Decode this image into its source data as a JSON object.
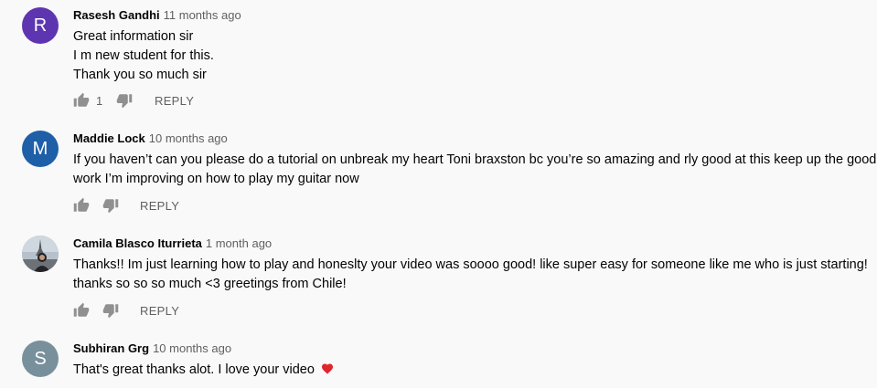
{
  "colors": {
    "avatar_r": "#5e35b1",
    "avatar_m": "#1e5fa8",
    "avatar_s": "#78909c",
    "heart": "#e0262c"
  },
  "comments": [
    {
      "author": "Rasesh Gandhi",
      "time": "11 months ago",
      "avatar_letter": "R",
      "lines": [
        "Great information sir",
        "I m new student for this.",
        "Thank you so much sir"
      ],
      "likes": "1",
      "reply": "REPLY"
    },
    {
      "author": "Maddie Lock",
      "time": "10 months ago",
      "avatar_letter": "M",
      "lines": [
        "If you haven’t can you please do a tutorial on unbreak my heart Toni braxston bc you’re so amazing and rly good at this keep up the good",
        "work I’m improving on how to play my guitar now"
      ],
      "reply": "REPLY"
    },
    {
      "author": "Camila Blasco Iturrieta",
      "time": "1 month ago",
      "avatar_letter": "",
      "lines": [
        "Thanks!! Im just learning how to play and honeslty your video was soooo good! like super easy for someone like me who is just starting!",
        "thanks so so so much <3 greetings from Chile!"
      ],
      "reply": "REPLY"
    },
    {
      "author": "Subhiran Grg",
      "time": "10 months ago",
      "avatar_letter": "S",
      "lines": [
        "That's great thanks alot. I love your video"
      ]
    }
  ]
}
